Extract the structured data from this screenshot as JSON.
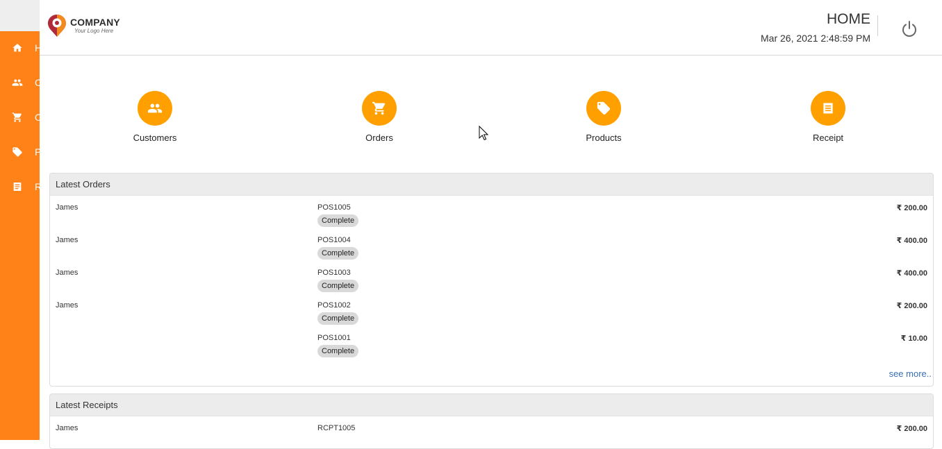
{
  "sidebar": {
    "items": [
      {
        "label": "H",
        "icon": "home-icon"
      },
      {
        "label": "C",
        "icon": "people-icon"
      },
      {
        "label": "O",
        "icon": "cart-icon"
      },
      {
        "label": "P",
        "icon": "tag-icon"
      },
      {
        "label": "R",
        "icon": "receipt-icon"
      }
    ],
    "color": "#ff8219"
  },
  "header": {
    "logo_company": "COMPANY",
    "logo_tagline": "Your Logo Here",
    "title": "HOME",
    "datetime": "Mar 26, 2021 2:48:59 PM"
  },
  "tiles": [
    {
      "label": "Customers",
      "icon": "people-icon"
    },
    {
      "label": "Orders",
      "icon": "cart-icon"
    },
    {
      "label": "Products",
      "icon": "tag-icon"
    },
    {
      "label": "Receipt",
      "icon": "receipt-icon"
    }
  ],
  "latest_orders": {
    "title": "Latest Orders",
    "rows": [
      {
        "customer": "James",
        "id": "POS1005",
        "status": "Complete",
        "amount": "₹ 200.00"
      },
      {
        "customer": "James",
        "id": "POS1004",
        "status": "Complete",
        "amount": "₹ 400.00"
      },
      {
        "customer": "James",
        "id": "POS1003",
        "status": "Complete",
        "amount": "₹ 400.00"
      },
      {
        "customer": "James",
        "id": "POS1002",
        "status": "Complete",
        "amount": "₹ 200.00"
      },
      {
        "customer": "",
        "id": "POS1001",
        "status": "Complete",
        "amount": "₹ 10.00"
      }
    ],
    "see_more": "see more.."
  },
  "latest_receipts": {
    "title": "Latest Receipts",
    "rows": [
      {
        "customer": "James",
        "id": "RCPT1005",
        "amount": "₹ 200.00"
      }
    ]
  },
  "colors": {
    "accent": "#ffa000",
    "sidebar": "#ff8219",
    "link": "#3a6fb5"
  }
}
